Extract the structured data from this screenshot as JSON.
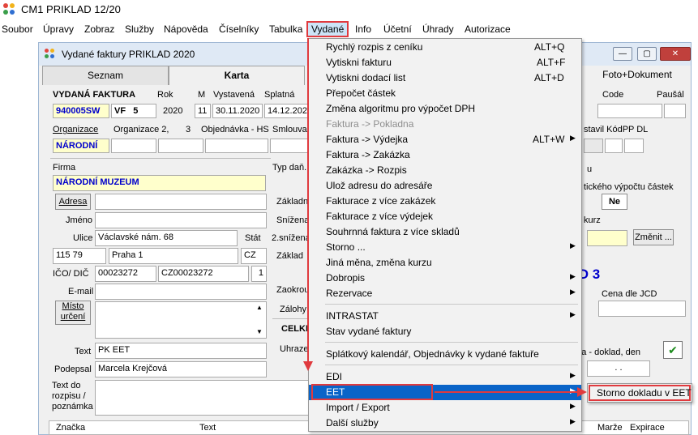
{
  "app": {
    "title": "CM1 PRIKLAD 12/20"
  },
  "menubar": {
    "items": [
      "Soubor",
      "Úpravy",
      "Zobraz",
      "Služby",
      "Nápověda",
      "Číselníky",
      "Tabulka",
      "Vydané",
      "Info",
      "Účetní",
      "Úhrady",
      "Autorizace"
    ]
  },
  "child": {
    "title": "Vydané faktury PRIKLAD  2020",
    "tabs": [
      "Seznam",
      "Karta",
      "Foto+Dokument"
    ]
  },
  "form": {
    "doc_label": "VYDANÁ FAKTURA",
    "rok_label": "Rok",
    "m_label": "M",
    "vystavena_label": "Vystavená",
    "splatna_label": "Splatná",
    "code_label": "Code",
    "pausal_label": "Paušál",
    "doc_number": "940005SW",
    "doc_type": "VF",
    "doc_series": "5",
    "rok": "2020",
    "m": "11",
    "vystavena": "30.11.2020",
    "splatna": "14.12.202",
    "organizace_label": "Organizace",
    "organizace2_label": "Organizace  2,",
    "organizace3_label": "3",
    "objednavka_label": "Objednávka - HS",
    "smlouva_label": "Smlouva",
    "vystavil_label": "stavil KódPP  DL",
    "organizace_value": "NÁRODNÍ",
    "firma_label": "Firma",
    "firma_value": "NÁRODNÍ MUZEUM",
    "adresa_button": "Adresa",
    "jmeno_label": "Jméno",
    "ulice_label": "Ulice",
    "ulice_value": "Václavské nám. 68",
    "stat_label": "Stát",
    "psc_value": "115 79",
    "mesto_value": "Praha 1",
    "stat_value": "CZ",
    "ico_label": "IČO/ DIČ",
    "ico_value": "00023272",
    "dic_value": "CZ00023272",
    "ico_extra": "1",
    "email_label": "E-mail",
    "misto_button": "Místo\nurčení",
    "text_label": "Text",
    "text_value": "PK EET",
    "podpis_label": "Podepsal",
    "podpis_value": "Marcela Krejčová",
    "textdo_label": "Text do\nrozpisu /\npoznámka",
    "typ_dan_label": "Typ daň.",
    "zakladn_label": "Základn",
    "snizena_label": "Snížena",
    "snizena2_label": "2.snížena",
    "zaklad_label": "Základ",
    "zaokrouh_label": "Zaokrou",
    "zalohy_label": "Zálohy",
    "celkem_label": "CELKE",
    "uhraze_label": "Uhraze",
    "u_label": "u",
    "automat_label": "tického výpočtu částek",
    "ne_button": "Ne",
    "kurz_label": "kurz",
    "zmenit_button": "Změnit ...",
    "id_label": "ID 3",
    "cena_label": "Cena dle JCD",
    "doklad_label": "ada - doklad, den",
    "date_dots": ". .",
    "col_znacka": "Značka",
    "col_text": "Text",
    "col_marze": "Marže",
    "col_expirace": "Expirace"
  },
  "dropdown": {
    "items": [
      {
        "label": "Rychlý rozpis z ceníku",
        "key": "ALT+Q"
      },
      {
        "label": "Vytiskni fakturu",
        "key": "ALT+F"
      },
      {
        "label": "Vytiskni dodací list",
        "key": "ALT+D"
      },
      {
        "label": "Přepočet  částek",
        "key": ""
      },
      {
        "label": "Změna algoritmu pro výpočet DPH",
        "key": ""
      },
      {
        "label": "Faktura -> Pokladna",
        "key": "",
        "disabled": true
      },
      {
        "label": "Faktura -> Výdejka",
        "key": "ALT+W",
        "sub": true
      },
      {
        "label": "Faktura -> Zakázka",
        "key": ""
      },
      {
        "label": "Zakázka -> Rozpis",
        "key": ""
      },
      {
        "label": "Ulož adresu do adresáře",
        "key": ""
      },
      {
        "label": "Fakturace z více zakázek",
        "key": ""
      },
      {
        "label": "Fakturace z více výdejek",
        "key": ""
      },
      {
        "label": "Souhrnná faktura z více skladů",
        "key": ""
      },
      {
        "label": "Storno ...",
        "key": "",
        "sub": true
      },
      {
        "label": "Jiná měna, změna kurzu",
        "key": ""
      },
      {
        "label": "Dobropis",
        "key": "",
        "sub": true
      },
      {
        "label": "Rezervace",
        "key": "",
        "sub": true
      },
      {
        "label": "INTRASTAT",
        "key": "",
        "sub": true
      },
      {
        "label": "Stav vydané faktury",
        "key": ""
      },
      {
        "label": "Splátkový kalendář, Objednávky k vydané faktuře",
        "key": ""
      },
      {
        "label": "EDI",
        "key": "",
        "sub": true
      },
      {
        "label": "EET",
        "key": "",
        "sub": true,
        "selected": true
      },
      {
        "label": "Import / Export",
        "key": "",
        "sub": true
      },
      {
        "label": "Další služby",
        "key": "",
        "sub": true
      }
    ]
  },
  "submenu": {
    "item": "Storno dokladu v EET"
  },
  "colors": {
    "highlight": "#e03a3e",
    "selection": "#0a64c8",
    "accent_blue": "#0000cc"
  }
}
